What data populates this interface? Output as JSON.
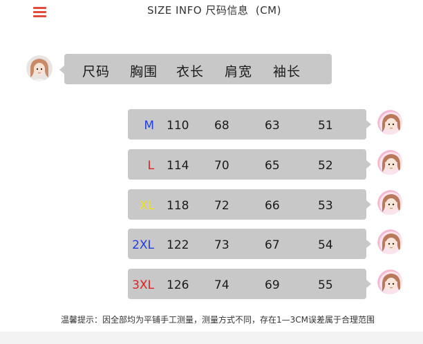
{
  "header": {
    "title": "SIZE INFO 尺码信息  (CM)",
    "menu_icon": "hamburger-menu-icon",
    "menu_color": "#e24a3b"
  },
  "columns": [
    "尺码",
    "胸围",
    "衣长",
    "肩宽",
    "袖长"
  ],
  "rows": [
    {
      "size": "M",
      "size_color": "#1f3fe0",
      "chest": "110",
      "length": "68",
      "shoulder": "63",
      "sleeve": "51"
    },
    {
      "size": "L",
      "size_color": "#e02020",
      "chest": "114",
      "length": "70",
      "shoulder": "65",
      "sleeve": "52"
    },
    {
      "size": "XL",
      "size_color": "#f0e020",
      "chest": "118",
      "length": "72",
      "shoulder": "66",
      "sleeve": "53"
    },
    {
      "size": "2XL",
      "size_color": "#1f3fe0",
      "chest": "122",
      "length": "73",
      "shoulder": "67",
      "sleeve": "54"
    },
    {
      "size": "3XL",
      "size_color": "#e02020",
      "chest": "126",
      "length": "74",
      "shoulder": "69",
      "sleeve": "55"
    }
  ],
  "footer": {
    "note": "温馨提示：因全部均为平铺手工测量，测量方式不同，存在1—3CM误差属于合理范围"
  },
  "colors": {
    "bubble": "#c8c8c8",
    "avatar_bg": "#f4b8d2"
  }
}
